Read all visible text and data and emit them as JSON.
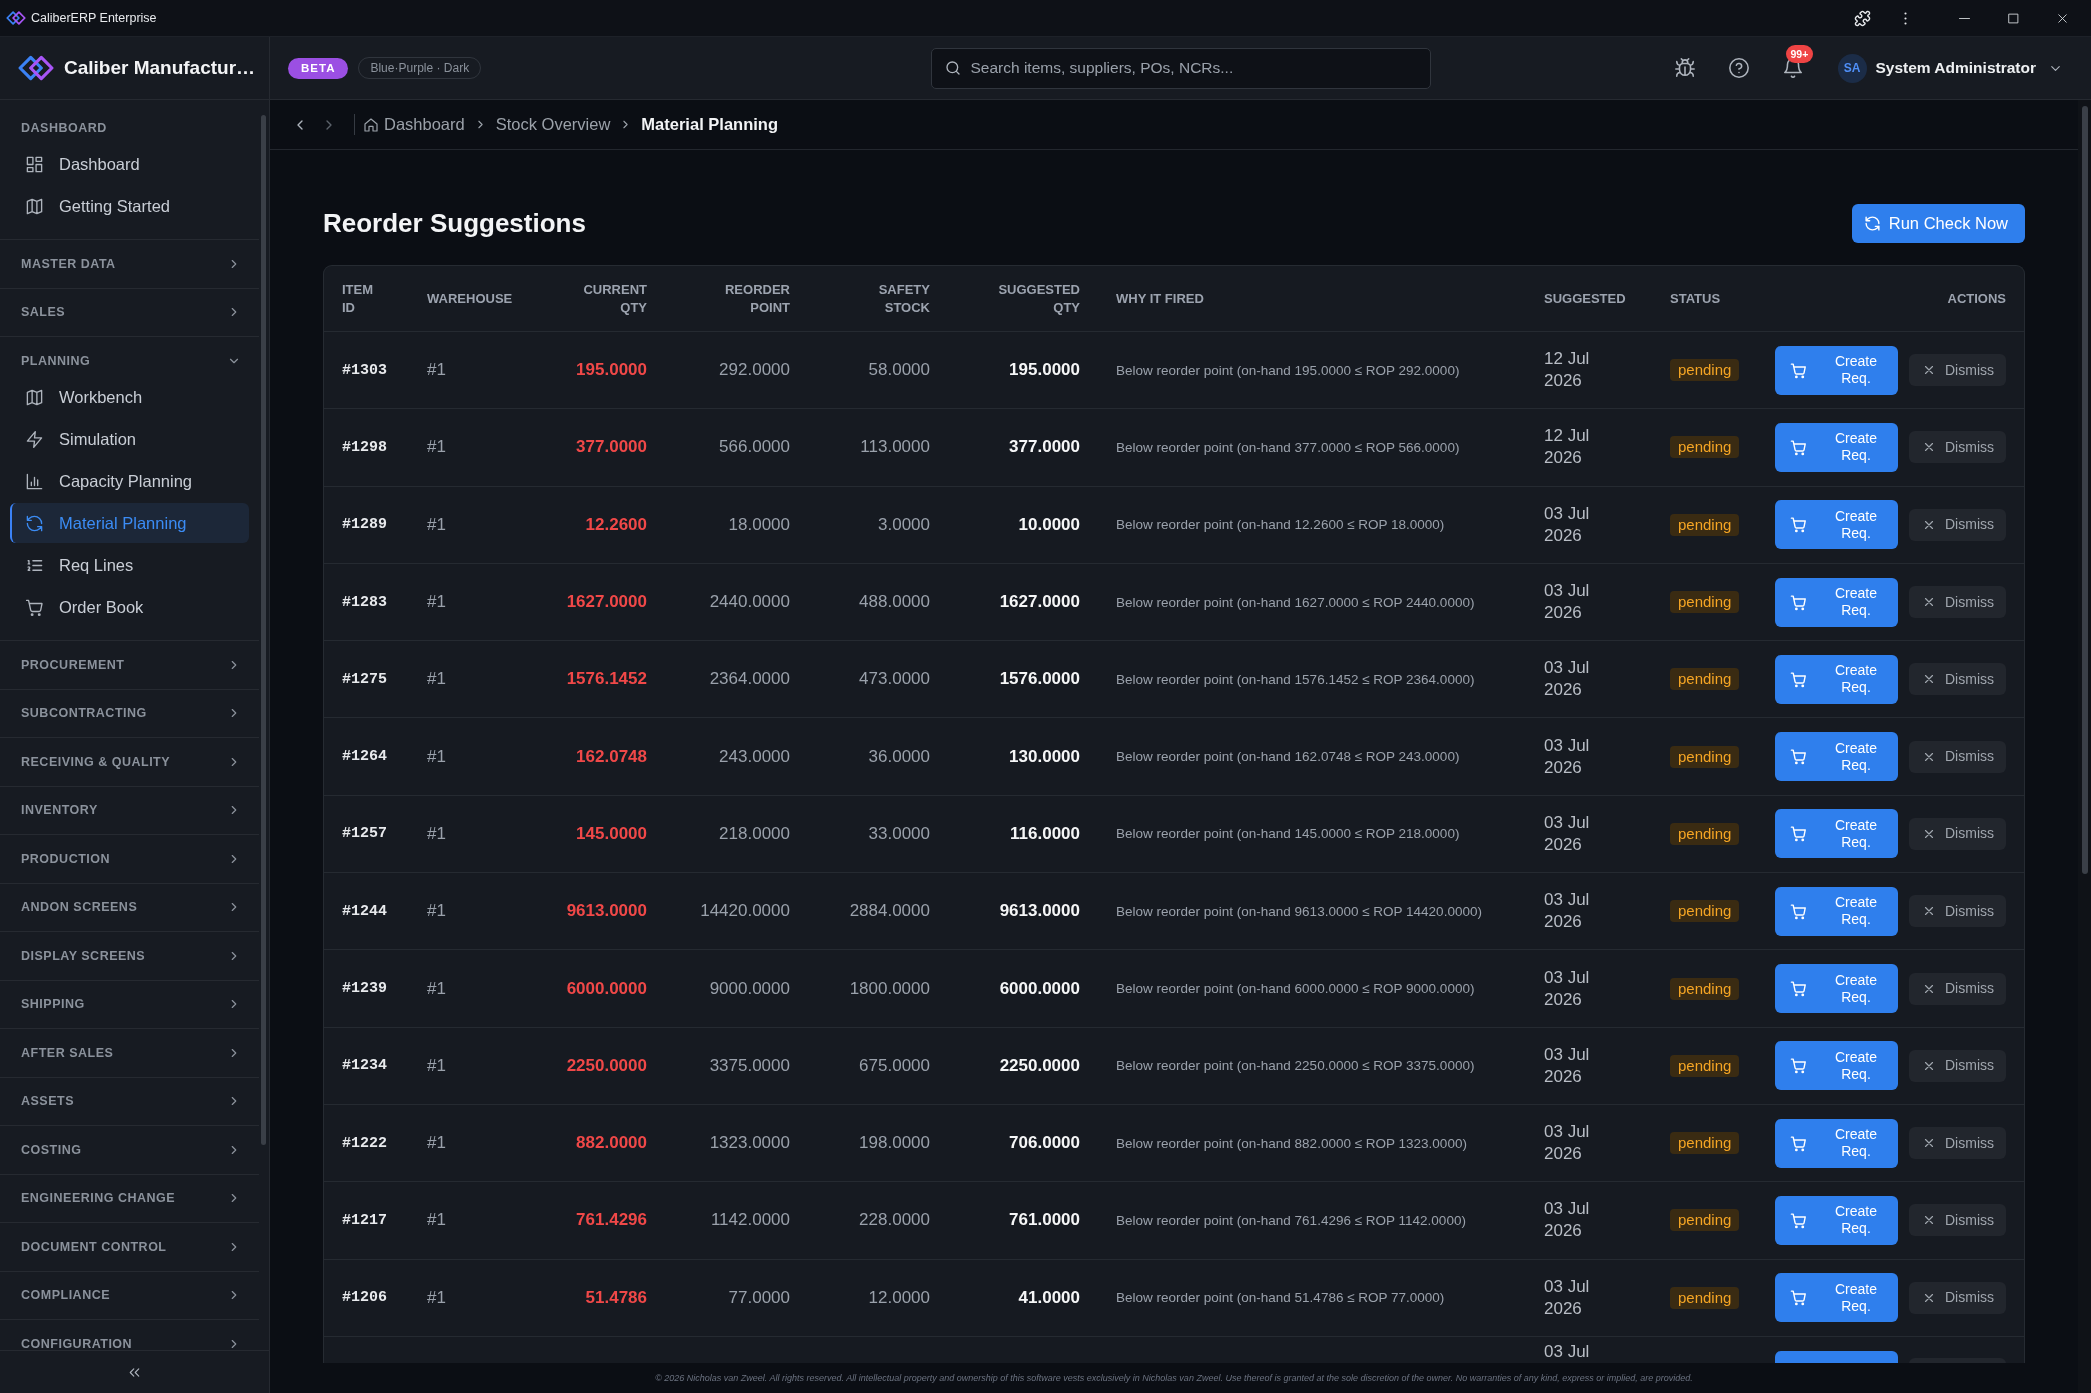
{
  "window": {
    "title": "CaliberERP Enterprise"
  },
  "sidebar": {
    "brand": "Caliber Manufactur…",
    "sections": [
      {
        "label": "DASHBOARD",
        "kind": "static",
        "items": [
          {
            "label": "Dashboard",
            "selected": false
          },
          {
            "label": "Getting Started",
            "selected": false
          }
        ]
      },
      {
        "label": "MASTER DATA",
        "kind": "collapsible",
        "expanded": false
      },
      {
        "label": "SALES",
        "kind": "collapsible",
        "expanded": false
      },
      {
        "label": "PLANNING",
        "kind": "collapsible",
        "expanded": true,
        "items": [
          {
            "label": "Workbench",
            "selected": false
          },
          {
            "label": "Simulation",
            "selected": false
          },
          {
            "label": "Capacity Planning",
            "selected": false
          },
          {
            "label": "Material Planning",
            "selected": true
          },
          {
            "label": "Req Lines",
            "selected": false
          },
          {
            "label": "Order Book",
            "selected": false
          }
        ]
      },
      {
        "label": "PROCUREMENT",
        "kind": "collapsible",
        "expanded": false
      },
      {
        "label": "SUBCONTRACTING",
        "kind": "collapsible",
        "expanded": false
      },
      {
        "label": "RECEIVING & QUALITY",
        "kind": "collapsible",
        "expanded": false
      },
      {
        "label": "INVENTORY",
        "kind": "collapsible",
        "expanded": false
      },
      {
        "label": "PRODUCTION",
        "kind": "collapsible",
        "expanded": false
      },
      {
        "label": "ANDON SCREENS",
        "kind": "collapsible",
        "expanded": false
      },
      {
        "label": "DISPLAY SCREENS",
        "kind": "collapsible",
        "expanded": false
      },
      {
        "label": "SHIPPING",
        "kind": "collapsible",
        "expanded": false
      },
      {
        "label": "AFTER SALES",
        "kind": "collapsible",
        "expanded": false
      },
      {
        "label": "ASSETS",
        "kind": "collapsible",
        "expanded": false
      },
      {
        "label": "COSTING",
        "kind": "collapsible",
        "expanded": false
      },
      {
        "label": "ENGINEERING CHANGE",
        "kind": "collapsible",
        "expanded": false
      },
      {
        "label": "DOCUMENT CONTROL",
        "kind": "collapsible",
        "expanded": false
      },
      {
        "label": "COMPLIANCE",
        "kind": "collapsible",
        "expanded": false
      },
      {
        "label": "CONFIGURATION",
        "kind": "collapsible",
        "expanded": false
      }
    ]
  },
  "header": {
    "badge": "BETA",
    "theme": "Blue·Purple · Dark",
    "search": {
      "placeholder": "Search items, suppliers, POs, NCRs..."
    },
    "notifications": "99+",
    "user": {
      "initials": "SA",
      "name": "System Administrator"
    }
  },
  "breadcrumb": {
    "history": [
      {
        "disabled": false
      },
      {
        "disabled": true
      }
    ],
    "items": [
      {
        "label": "Dashboard",
        "current": false
      },
      {
        "label": "Stock Overview",
        "current": false
      },
      {
        "label": "Material Planning",
        "current": true
      }
    ]
  },
  "page": {
    "title": "Reorder Suggestions",
    "action": "Run Check Now"
  },
  "table": {
    "columns": [
      "ITEM ID",
      "WAREHOUSE",
      "CURRENT QTY",
      "REORDER POINT",
      "SAFETY STOCK",
      "SUGGESTED QTY",
      "WHY IT FIRED",
      "SUGGESTED",
      "STATUS",
      "ACTIONS"
    ],
    "rows": [
      {
        "item_id": "#1303",
        "warehouse": "#1",
        "current_qty": "195.0000",
        "reorder_point": "292.0000",
        "safety_stock": "58.0000",
        "suggested_qty": "195.0000",
        "reason": "Below reorder point (on-hand 195.0000 ≤ ROP 292.0000)",
        "suggested": "12 Jul 2026",
        "status": "pending",
        "actions": [
          {
            "label": "Create Req.",
            "kind": "primary"
          },
          {
            "label": "Dismiss",
            "kind": "secondary"
          }
        ]
      },
      {
        "item_id": "#1298",
        "warehouse": "#1",
        "current_qty": "377.0000",
        "reorder_point": "566.0000",
        "safety_stock": "113.0000",
        "suggested_qty": "377.0000",
        "reason": "Below reorder point (on-hand 377.0000 ≤ ROP 566.0000)",
        "suggested": "12 Jul 2026",
        "status": "pending",
        "actions": [
          {
            "label": "Create Req.",
            "kind": "primary"
          },
          {
            "label": "Dismiss",
            "kind": "secondary"
          }
        ]
      },
      {
        "item_id": "#1289",
        "warehouse": "#1",
        "current_qty": "12.2600",
        "reorder_point": "18.0000",
        "safety_stock": "3.0000",
        "suggested_qty": "10.0000",
        "reason": "Below reorder point (on-hand 12.2600 ≤ ROP 18.0000)",
        "suggested": "03 Jul 2026",
        "status": "pending",
        "actions": [
          {
            "label": "Create Req.",
            "kind": "primary"
          },
          {
            "label": "Dismiss",
            "kind": "secondary"
          }
        ]
      },
      {
        "item_id": "#1283",
        "warehouse": "#1",
        "current_qty": "1627.0000",
        "reorder_point": "2440.0000",
        "safety_stock": "488.0000",
        "suggested_qty": "1627.0000",
        "reason": "Below reorder point (on-hand 1627.0000 ≤ ROP 2440.0000)",
        "suggested": "03 Jul 2026",
        "status": "pending",
        "actions": [
          {
            "label": "Create Req.",
            "kind": "primary"
          },
          {
            "label": "Dismiss",
            "kind": "secondary"
          }
        ]
      },
      {
        "item_id": "#1275",
        "warehouse": "#1",
        "current_qty": "1576.1452",
        "reorder_point": "2364.0000",
        "safety_stock": "473.0000",
        "suggested_qty": "1576.0000",
        "reason": "Below reorder point (on-hand 1576.1452 ≤ ROP 2364.0000)",
        "suggested": "03 Jul 2026",
        "status": "pending",
        "actions": [
          {
            "label": "Create Req.",
            "kind": "primary"
          },
          {
            "label": "Dismiss",
            "kind": "secondary"
          }
        ]
      },
      {
        "item_id": "#1264",
        "warehouse": "#1",
        "current_qty": "162.0748",
        "reorder_point": "243.0000",
        "safety_stock": "36.0000",
        "suggested_qty": "130.0000",
        "reason": "Below reorder point (on-hand 162.0748 ≤ ROP 243.0000)",
        "suggested": "03 Jul 2026",
        "status": "pending",
        "actions": [
          {
            "label": "Create Req.",
            "kind": "primary"
          },
          {
            "label": "Dismiss",
            "kind": "secondary"
          }
        ]
      },
      {
        "item_id": "#1257",
        "warehouse": "#1",
        "current_qty": "145.0000",
        "reorder_point": "218.0000",
        "safety_stock": "33.0000",
        "suggested_qty": "116.0000",
        "reason": "Below reorder point (on-hand 145.0000 ≤ ROP 218.0000)",
        "suggested": "03 Jul 2026",
        "status": "pending",
        "actions": [
          {
            "label": "Create Req.",
            "kind": "primary"
          },
          {
            "label": "Dismiss",
            "kind": "secondary"
          }
        ]
      },
      {
        "item_id": "#1244",
        "warehouse": "#1",
        "current_qty": "9613.0000",
        "reorder_point": "14420.0000",
        "safety_stock": "2884.0000",
        "suggested_qty": "9613.0000",
        "reason": "Below reorder point (on-hand 9613.0000 ≤ ROP 14420.0000)",
        "suggested": "03 Jul 2026",
        "status": "pending",
        "actions": [
          {
            "label": "Create Req.",
            "kind": "primary"
          },
          {
            "label": "Dismiss",
            "kind": "secondary"
          }
        ]
      },
      {
        "item_id": "#1239",
        "warehouse": "#1",
        "current_qty": "6000.0000",
        "reorder_point": "9000.0000",
        "safety_stock": "1800.0000",
        "suggested_qty": "6000.0000",
        "reason": "Below reorder point (on-hand 6000.0000 ≤ ROP 9000.0000)",
        "suggested": "03 Jul 2026",
        "status": "pending",
        "actions": [
          {
            "label": "Create Req.",
            "kind": "primary"
          },
          {
            "label": "Dismiss",
            "kind": "secondary"
          }
        ]
      },
      {
        "item_id": "#1234",
        "warehouse": "#1",
        "current_qty": "2250.0000",
        "reorder_point": "3375.0000",
        "safety_stock": "675.0000",
        "suggested_qty": "2250.0000",
        "reason": "Below reorder point (on-hand 2250.0000 ≤ ROP 3375.0000)",
        "suggested": "03 Jul 2026",
        "status": "pending",
        "actions": [
          {
            "label": "Create Req.",
            "kind": "primary"
          },
          {
            "label": "Dismiss",
            "kind": "secondary"
          }
        ]
      },
      {
        "item_id": "#1222",
        "warehouse": "#1",
        "current_qty": "882.0000",
        "reorder_point": "1323.0000",
        "safety_stock": "198.0000",
        "suggested_qty": "706.0000",
        "reason": "Below reorder point (on-hand 882.0000 ≤ ROP 1323.0000)",
        "suggested": "03 Jul 2026",
        "status": "pending",
        "actions": [
          {
            "label": "Create Req.",
            "kind": "primary"
          },
          {
            "label": "Dismiss",
            "kind": "secondary"
          }
        ]
      },
      {
        "item_id": "#1217",
        "warehouse": "#1",
        "current_qty": "761.4296",
        "reorder_point": "1142.0000",
        "safety_stock": "228.0000",
        "suggested_qty": "761.0000",
        "reason": "Below reorder point (on-hand 761.4296 ≤ ROP 1142.0000)",
        "suggested": "03 Jul 2026",
        "status": "pending",
        "actions": [
          {
            "label": "Create Req.",
            "kind": "primary"
          },
          {
            "label": "Dismiss",
            "kind": "secondary"
          }
        ]
      },
      {
        "item_id": "#1206",
        "warehouse": "#1",
        "current_qty": "51.4786",
        "reorder_point": "77.0000",
        "safety_stock": "12.0000",
        "suggested_qty": "41.0000",
        "reason": "Below reorder point (on-hand 51.4786 ≤ ROP 77.0000)",
        "suggested": "03 Jul 2026",
        "status": "pending",
        "actions": [
          {
            "label": "Create Req.",
            "kind": "primary"
          },
          {
            "label": "Dismiss",
            "kind": "secondary"
          }
        ]
      }
    ],
    "partial_row": {
      "suggested": "03 Jul",
      "actions": [
        {
          "kind": "primary"
        },
        {
          "kind": "secondary"
        }
      ]
    }
  },
  "footer": "© 2026 Nicholas van Zweel. All rights reserved. All intellectual property and ownership of this software vests exclusively in Nicholas van Zweel. Use thereof is granted at the sole discretion of the owner. No warranties of any kind, express or implied, are provided."
}
